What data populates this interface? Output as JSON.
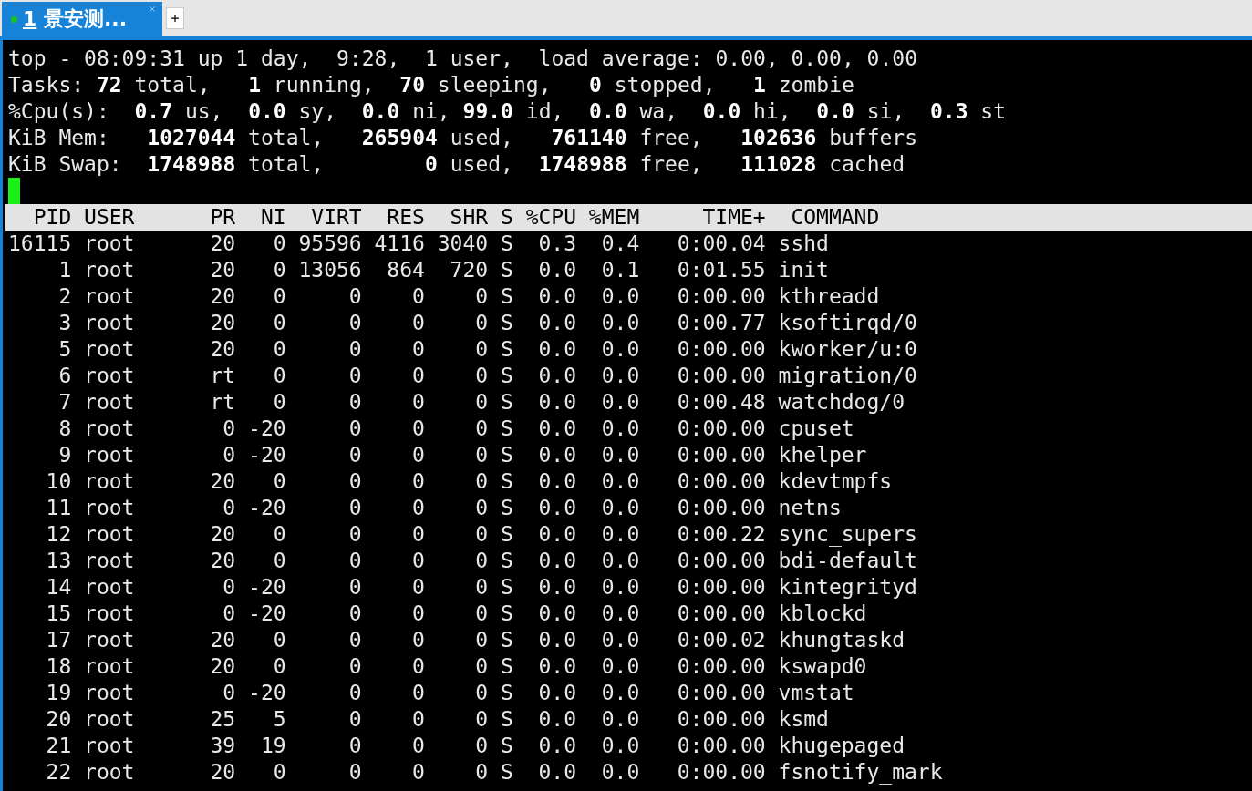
{
  "tabs": [
    {
      "number": "1",
      "title": "景安测...",
      "selected": true,
      "connected": true
    }
  ],
  "summary": [
    "top - 08:09:31 up 1 day,  9:28,  1 user,  load average: 0.00, 0.00, 0.00",
    "Tasks: **72** total,   **1** running,  **70** sleeping,   **0** stopped,   **1** zombie",
    "%Cpu(s):  **0.7** us,  **0.0** sy,  **0.0** ni, **99.0** id,  **0.0** wa,  **0.0** hi,  **0.0** si,  **0.3** st",
    "KiB Mem:   **1027044** total,   **265904** used,   **761140** free,   **102636** buffers",
    "KiB Swap:  **1748988** total,        **0** used,  **1748988** free,   **111028** cached"
  ],
  "table": {
    "columns": [
      "PID",
      "USER",
      "PR",
      "NI",
      "VIRT",
      "RES",
      "SHR",
      "S",
      "%CPU",
      "%MEM",
      "TIME+",
      "COMMAND"
    ],
    "rows": [
      [
        "16115",
        "root",
        "20",
        "0",
        "95596",
        "4116",
        "3040",
        "S",
        "0.3",
        "0.4",
        "0:00.04",
        "sshd"
      ],
      [
        "1",
        "root",
        "20",
        "0",
        "13056",
        "864",
        "720",
        "S",
        "0.0",
        "0.1",
        "0:01.55",
        "init"
      ],
      [
        "2",
        "root",
        "20",
        "0",
        "0",
        "0",
        "0",
        "S",
        "0.0",
        "0.0",
        "0:00.00",
        "kthreadd"
      ],
      [
        "3",
        "root",
        "20",
        "0",
        "0",
        "0",
        "0",
        "S",
        "0.0",
        "0.0",
        "0:00.77",
        "ksoftirqd/0"
      ],
      [
        "5",
        "root",
        "20",
        "0",
        "0",
        "0",
        "0",
        "S",
        "0.0",
        "0.0",
        "0:00.00",
        "kworker/u:0"
      ],
      [
        "6",
        "root",
        "rt",
        "0",
        "0",
        "0",
        "0",
        "S",
        "0.0",
        "0.0",
        "0:00.00",
        "migration/0"
      ],
      [
        "7",
        "root",
        "rt",
        "0",
        "0",
        "0",
        "0",
        "S",
        "0.0",
        "0.0",
        "0:00.48",
        "watchdog/0"
      ],
      [
        "8",
        "root",
        "0",
        "-20",
        "0",
        "0",
        "0",
        "S",
        "0.0",
        "0.0",
        "0:00.00",
        "cpuset"
      ],
      [
        "9",
        "root",
        "0",
        "-20",
        "0",
        "0",
        "0",
        "S",
        "0.0",
        "0.0",
        "0:00.00",
        "khelper"
      ],
      [
        "10",
        "root",
        "20",
        "0",
        "0",
        "0",
        "0",
        "S",
        "0.0",
        "0.0",
        "0:00.00",
        "kdevtmpfs"
      ],
      [
        "11",
        "root",
        "0",
        "-20",
        "0",
        "0",
        "0",
        "S",
        "0.0",
        "0.0",
        "0:00.00",
        "netns"
      ],
      [
        "12",
        "root",
        "20",
        "0",
        "0",
        "0",
        "0",
        "S",
        "0.0",
        "0.0",
        "0:00.22",
        "sync_supers"
      ],
      [
        "13",
        "root",
        "20",
        "0",
        "0",
        "0",
        "0",
        "S",
        "0.0",
        "0.0",
        "0:00.00",
        "bdi-default"
      ],
      [
        "14",
        "root",
        "0",
        "-20",
        "0",
        "0",
        "0",
        "S",
        "0.0",
        "0.0",
        "0:00.00",
        "kintegrityd"
      ],
      [
        "15",
        "root",
        "0",
        "-20",
        "0",
        "0",
        "0",
        "S",
        "0.0",
        "0.0",
        "0:00.00",
        "kblockd"
      ],
      [
        "17",
        "root",
        "20",
        "0",
        "0",
        "0",
        "0",
        "S",
        "0.0",
        "0.0",
        "0:00.02",
        "khungtaskd"
      ],
      [
        "18",
        "root",
        "20",
        "0",
        "0",
        "0",
        "0",
        "S",
        "0.0",
        "0.0",
        "0:00.00",
        "kswapd0"
      ],
      [
        "19",
        "root",
        "0",
        "-20",
        "0",
        "0",
        "0",
        "S",
        "0.0",
        "0.0",
        "0:00.00",
        "vmstat"
      ],
      [
        "20",
        "root",
        "25",
        "5",
        "0",
        "0",
        "0",
        "S",
        "0.0",
        "0.0",
        "0:00.00",
        "ksmd"
      ],
      [
        "21",
        "root",
        "39",
        "19",
        "0",
        "0",
        "0",
        "S",
        "0.0",
        "0.0",
        "0:00.00",
        "khugepaged"
      ],
      [
        "22",
        "root",
        "20",
        "0",
        "0",
        "0",
        "0",
        "S",
        "0.0",
        "0.0",
        "0:00.00",
        "fsnotify_mark"
      ]
    ]
  }
}
